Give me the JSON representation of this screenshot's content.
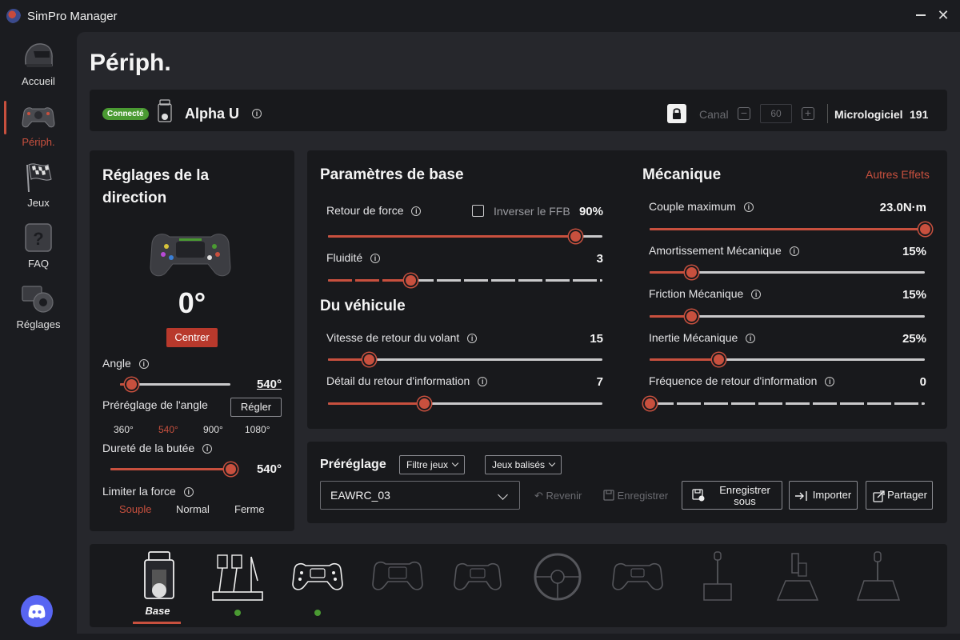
{
  "app": {
    "title": "SimPro Manager",
    "close_glyph": "✕"
  },
  "sidebar": {
    "items": [
      {
        "label": "Accueil",
        "icon": "helmet-icon"
      },
      {
        "label": "Périph.",
        "icon": "wheel-icon"
      },
      {
        "label": "Jeux",
        "icon": "flag-icon"
      },
      {
        "label": "FAQ",
        "icon": "question-icon"
      },
      {
        "label": "Réglages",
        "icon": "settings-icon"
      }
    ],
    "active": "Périph.",
    "discord_icon": "discord-icon"
  },
  "page": {
    "title": "Périph."
  },
  "device": {
    "status": "Connecté",
    "name": "Alpha U",
    "canal_label": "Canal",
    "canal_value": "60",
    "firmware_label": "Micrologiciel",
    "firmware_value": "191"
  },
  "steering": {
    "title": "Réglages de la direction",
    "angle_display": "0°",
    "center_button": "Centrer",
    "angle_label": "Angle",
    "angle_value": "540°",
    "angle_fraction": 0.1,
    "preset_label": "Préréglage de l'angle",
    "preset_button": "Régler",
    "preset_options": [
      "360°",
      "540°",
      "900°",
      "1080°"
    ],
    "preset_selected": "540°",
    "stop_label": "Dureté de la butée",
    "stop_value": "540°",
    "stop_fraction": 1.0,
    "force_limit_label": "Limiter la force",
    "force_limit_options": [
      "Souple",
      "Normal",
      "Ferme"
    ],
    "force_limit_selected": "Souple"
  },
  "base_params": {
    "title": "Paramètres de base",
    "ffb_label": "Retour de force",
    "invert_label": "Inverser le FFB",
    "invert_checked": false,
    "ffb_value": "90%",
    "ffb_fraction": 0.9,
    "smooth_label": "Fluidité",
    "smooth_value": "3",
    "smooth_fraction": 0.3
  },
  "vehicle": {
    "title": "Du véhicule",
    "return_speed_label": "Vitesse de retour du volant",
    "return_speed_value": "15",
    "return_speed_fraction": 0.15,
    "feedback_detail_label": "Détail du retour d'information",
    "feedback_detail_value": "7",
    "feedback_detail_fraction": 0.35
  },
  "mechanics": {
    "title": "Mécanique",
    "other_effects": "Autres Effets",
    "torque_label": "Couple maximum",
    "torque_value": "23.0N·m",
    "torque_fraction": 1.0,
    "damping_label": "Amortissement Mécanique",
    "damping_value": "15%",
    "damping_fraction": 0.15,
    "friction_label": "Friction Mécanique",
    "friction_value": "15%",
    "friction_fraction": 0.15,
    "inertia_label": "Inertie Mécanique",
    "inertia_value": "25%",
    "inertia_fraction": 0.25,
    "freq_label": "Fréquence de retour d'information",
    "freq_value": "0",
    "freq_fraction": 0.0
  },
  "presets": {
    "title": "Préréglage",
    "filter_games": "Filtre jeux",
    "tagged_games": "Jeux balisés",
    "selected": "EAWRC_03",
    "revert": "Revenir",
    "save": "Enregistrer",
    "save_as": "Enregistrer sous",
    "import": "Importer",
    "share": "Partager"
  },
  "devices_strip": {
    "active_label": "Base",
    "connected": [
      true,
      true,
      true,
      false,
      false,
      false,
      false,
      false,
      false,
      false
    ]
  },
  "colors": {
    "accent": "#c8503e",
    "connected": "#4a9a32",
    "background": "#26272c",
    "panel": "#18191c"
  }
}
